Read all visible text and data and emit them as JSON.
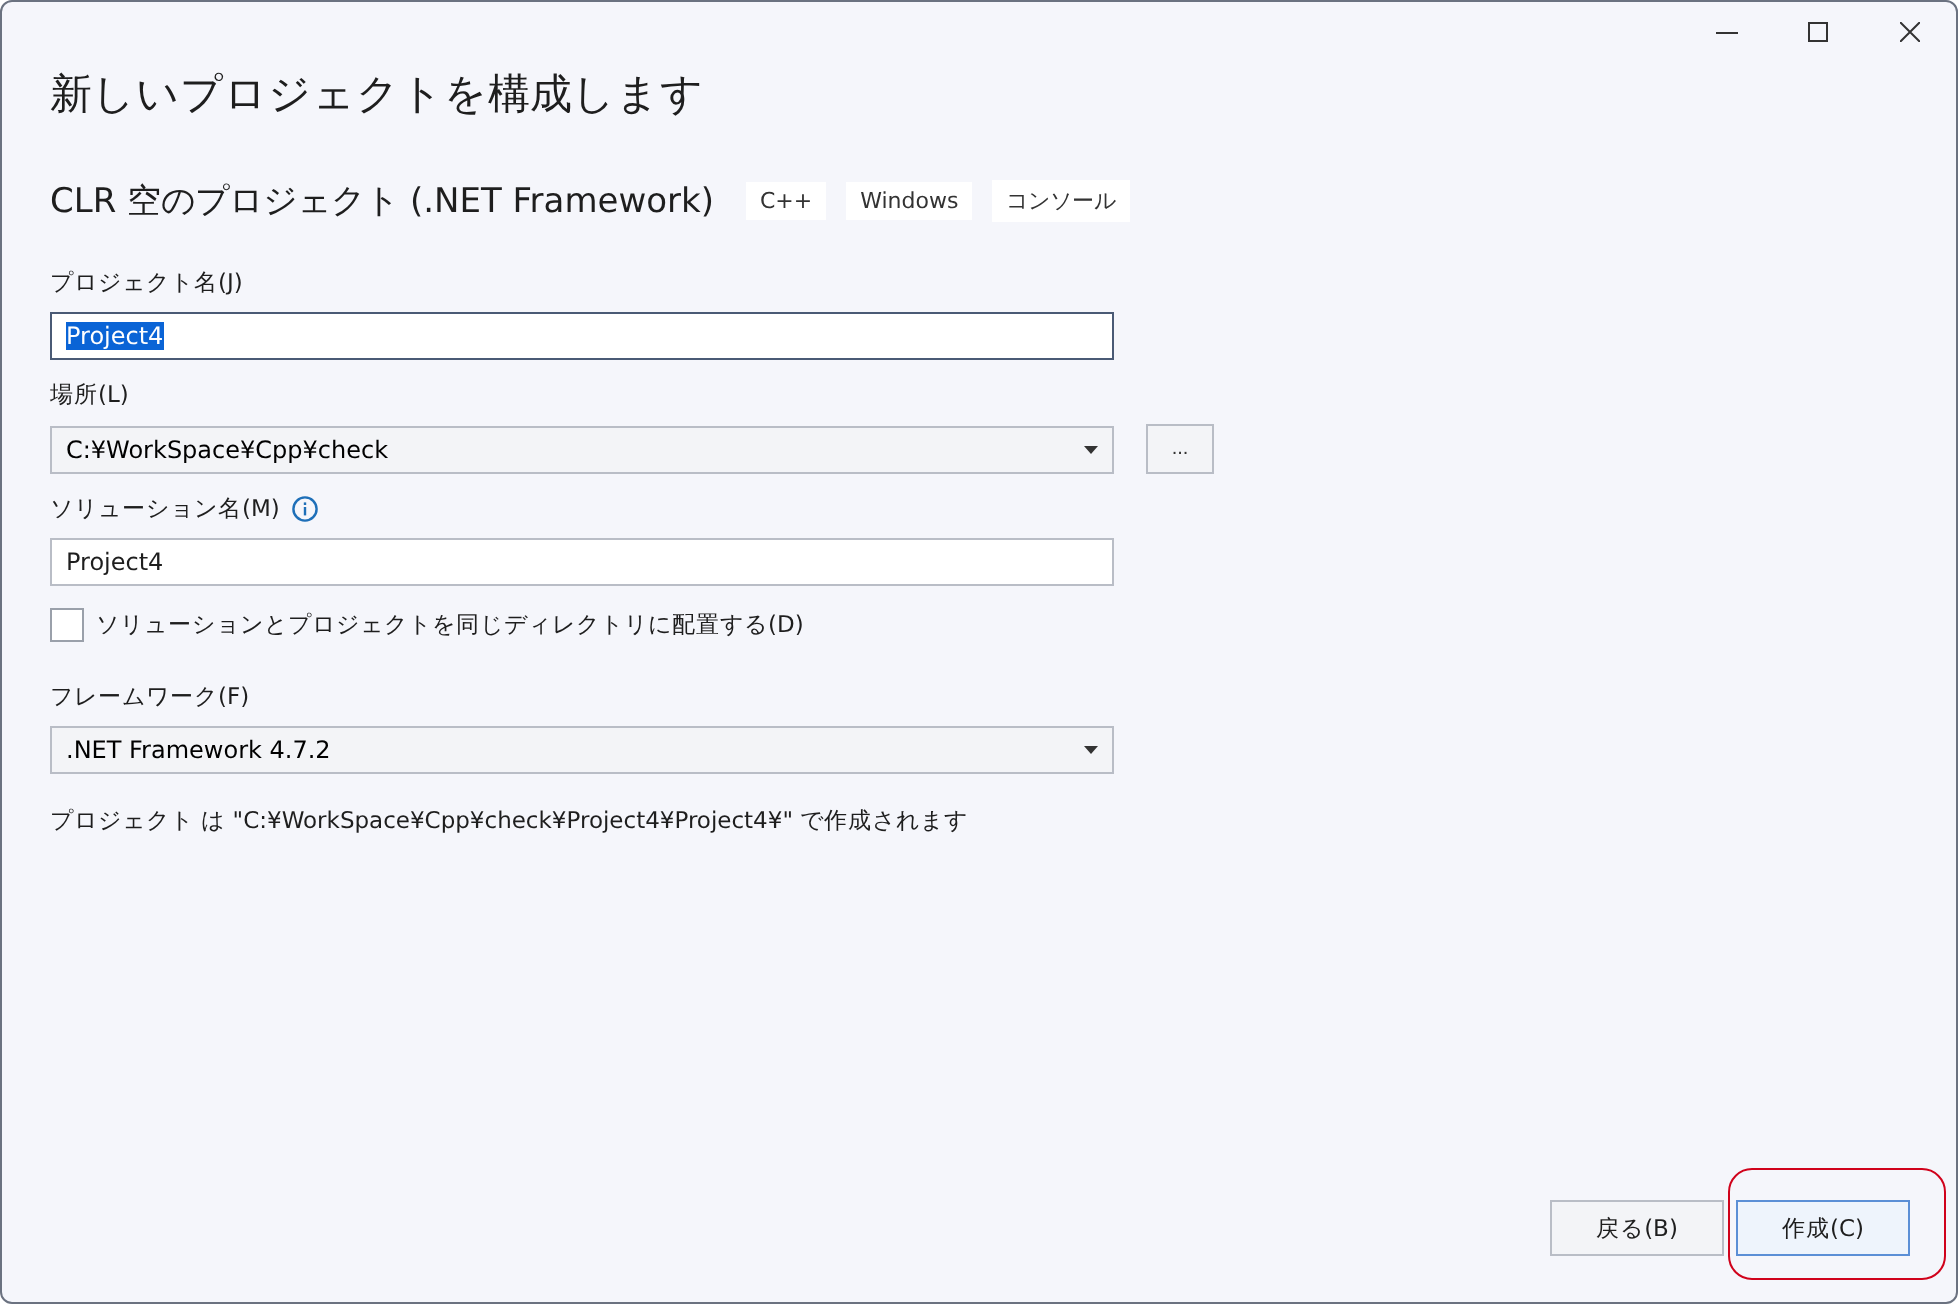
{
  "window": {
    "title": "新しいプロジェクトを構成します",
    "controls": [
      {
        "kind": "minimize"
      },
      {
        "kind": "maximize"
      },
      {
        "kind": "close"
      }
    ]
  },
  "template": {
    "name": "CLR 空のプロジェクト (.NET Framework)",
    "tags": [
      "C++",
      "Windows",
      "コンソール"
    ]
  },
  "fields": [
    {
      "kind": "text",
      "label": "プロジェクト名(J)",
      "value": "Project4",
      "selected_text": true
    },
    {
      "kind": "combo",
      "label": "場所(L)",
      "value": "C:¥WorkSpace¥Cpp¥check",
      "browse": "..."
    },
    {
      "kind": "text",
      "label": "ソリューション名(M)",
      "value": "Project4",
      "info": true,
      "selected_text": false
    },
    {
      "kind": "checkbox",
      "label": "ソリューションとプロジェクトを同じディレクトリに配置する(D)",
      "checked": false
    },
    {
      "kind": "combo",
      "label": "フレームワーク(F)",
      "value": ".NET Framework 4.7.2"
    }
  ],
  "summary": "プロジェクト は \"C:¥WorkSpace¥Cpp¥check¥Project4¥Project4¥\" で作成されます",
  "buttons": [
    {
      "label": "戻る(B)",
      "primary": false,
      "highlighted": false
    },
    {
      "label": "作成(C)",
      "primary": true,
      "highlighted": true
    }
  ]
}
